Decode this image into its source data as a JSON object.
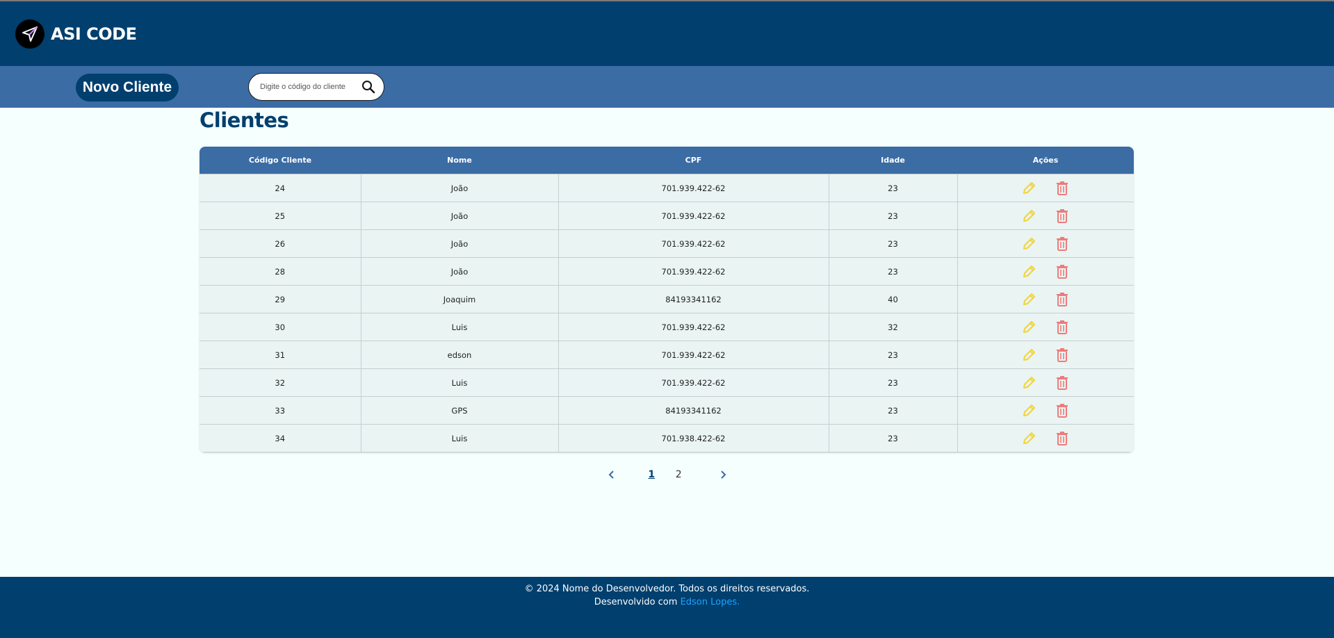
{
  "header": {
    "brand": "ASI CODE"
  },
  "toolbar": {
    "new_client_label": "Novo Cliente",
    "search_placeholder": "Digite o código do cliente"
  },
  "main": {
    "title": "Clientes",
    "columns": [
      "Código Cliente",
      "Nome",
      "CPF",
      "Idade",
      "Ações"
    ],
    "rows": [
      {
        "codigo": "24",
        "nome": "João",
        "cpf": "701.939.422-62",
        "idade": "23"
      },
      {
        "codigo": "25",
        "nome": "João",
        "cpf": "701.939.422-62",
        "idade": "23"
      },
      {
        "codigo": "26",
        "nome": "João",
        "cpf": "701.939.422-62",
        "idade": "23"
      },
      {
        "codigo": "28",
        "nome": "João",
        "cpf": "701.939.422-62",
        "idade": "23"
      },
      {
        "codigo": "29",
        "nome": "Joaquim",
        "cpf": "84193341162",
        "idade": "40"
      },
      {
        "codigo": "30",
        "nome": "Luis",
        "cpf": "701.939.422-62",
        "idade": "32"
      },
      {
        "codigo": "31",
        "nome": "edson",
        "cpf": "701.939.422-62",
        "idade": "23"
      },
      {
        "codigo": "32",
        "nome": "Luis",
        "cpf": "701.939.422-62",
        "idade": "23"
      },
      {
        "codigo": "33",
        "nome": "GPS",
        "cpf": "84193341162",
        "idade": "23"
      },
      {
        "codigo": "34",
        "nome": "Luis",
        "cpf": "701.938.422-62",
        "idade": "23"
      }
    ],
    "row_actions": [
      "pencil-icon",
      "trash-icon"
    ]
  },
  "pagination": {
    "pages": [
      "1",
      "2"
    ],
    "current": "1"
  },
  "footer": {
    "copyright": "© 2024 Nome do Desenvolvedor. Todos os direitos reservados.",
    "developed_prefix": "Desenvolvido com ",
    "developer_link": "Edson Lopes."
  },
  "colors": {
    "header_bg": "#003f6e",
    "subbar_bg": "#3b6ca4",
    "page_bg": "#f4fffe",
    "row_bg": "#e9f4f3",
    "edit_icon": "#f2d43a",
    "delete_icon": "#ee7b7b",
    "link": "#1ea3ff"
  }
}
